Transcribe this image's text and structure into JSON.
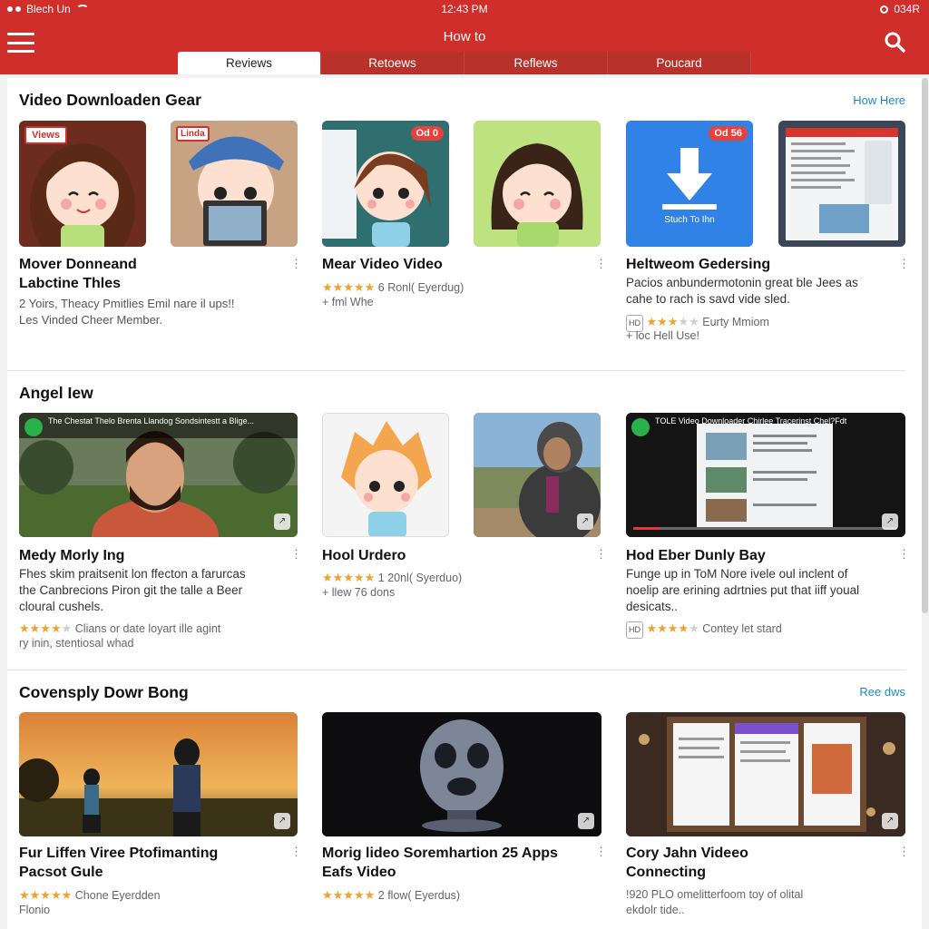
{
  "status_bar": {
    "carrier": "Blech Un",
    "time": "12:43 PM",
    "battery": "034R"
  },
  "header": {
    "title": "How to"
  },
  "tabs": [
    {
      "label": "Reviews"
    },
    {
      "label": "Retoews"
    },
    {
      "label": "Reflews"
    },
    {
      "label": "Poucard"
    }
  ],
  "sections": [
    {
      "title": "Video Downloaden Gear",
      "link": "How Here",
      "cards": [
        {
          "badge": "Views",
          "title1": "Mover Donneand",
          "title2": "Labctine Thles",
          "desc1": "2 Yoirs, Theacy Pmitlies Emil nare il ups!!",
          "desc2": "Les Vinded Cheer Member."
        },
        {
          "badge": "Linda"
        },
        {
          "badge": "Od 0",
          "title1": "Mear Video Video",
          "rating": "6 Ronl( Eyerdug)",
          "meta": "+ fml Whe"
        },
        {},
        {
          "badge": "Od 56",
          "thumb_label": "Stuch To Ihn",
          "title1": "Heltweom Gedersing",
          "desc1": "Pacios anbundermotonin great ble Jees as",
          "desc2": "cahe to rach is savd vide sled.",
          "meta1": "Eurty Mmiom",
          "meta2": "+ loc Hell Use!"
        }
      ]
    },
    {
      "title": "Angel Iew",
      "cards": [
        {
          "overlay": "The Chestat Thelo Brenta Llandog Sondsintestt a Blige...",
          "title1": "Medy Morly Ing",
          "desc1": "Fhes skim praitsenit lon ffecton a farurcas",
          "desc2": "the Canbrecions Piron git the talle a Beer",
          "desc3": "cloural cushels.",
          "meta1": "Clians or date loyart ille agint",
          "meta2": "ry inin, stentiosal whad"
        },
        {
          "title1": "Hool Urdero",
          "rating": "1 20nl( Syerduo)",
          "meta": "+ llew 76 dons"
        },
        {
          "overlay": "TOLE Video Downloader Chirlee Tracerinst Chel?Fdt",
          "title1": "Hod Eber Dunly Bay",
          "desc1": "Funge up in ToM Nore ivele oul inclent of",
          "desc2": "noelip are erining adrtnies put that iiff youal",
          "desc3": "desicats..",
          "meta1": "Contey let stard"
        }
      ]
    },
    {
      "title": "Covensply Dowr Bong",
      "link": "Ree dws",
      "cards": [
        {
          "title1": "Fur Liffen Viree Ptofimanting",
          "title2": "Pacsot Gule",
          "rating": "Chone Eyerdden",
          "meta": "Flonio"
        },
        {
          "title1": "Morig lideo Soremhartion 25 Apps",
          "title2": "Eafs Video",
          "rating": "2 flow( Eyerdus)"
        },
        {
          "title1": "Cory Jahn Videeo",
          "title2": "Connecting",
          "desc1": "!920 PLO omelitterfoom toy of olital",
          "desc2": "ekdolr tide.."
        }
      ]
    }
  ],
  "colors": {
    "brand_red": "#cf2e2a",
    "link_blue": "#1b8ac2",
    "star": "#f0a22a"
  }
}
